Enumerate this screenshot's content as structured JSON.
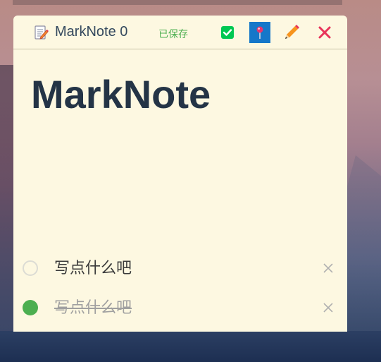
{
  "titlebar": {
    "app_icon": "notepad-pencil-icon",
    "title": "MarkNote 0",
    "status": "已保存",
    "buttons": {
      "done": "check-icon",
      "pin": "pin-icon",
      "edit": "pencil-icon",
      "close": "close-icon"
    }
  },
  "note": {
    "heading": "MarkNote"
  },
  "todos": [
    {
      "text": "写点什么吧",
      "done": false
    },
    {
      "text": "写点什么吧",
      "done": true
    }
  ],
  "colors": {
    "note_background": "#fdf8e1",
    "saved_status": "#4caf50",
    "heading": "#243446",
    "check_button": "#00c853",
    "pin_button": "#1577c9",
    "close_button": "#e8345a",
    "done_circle": "#4caf50"
  }
}
